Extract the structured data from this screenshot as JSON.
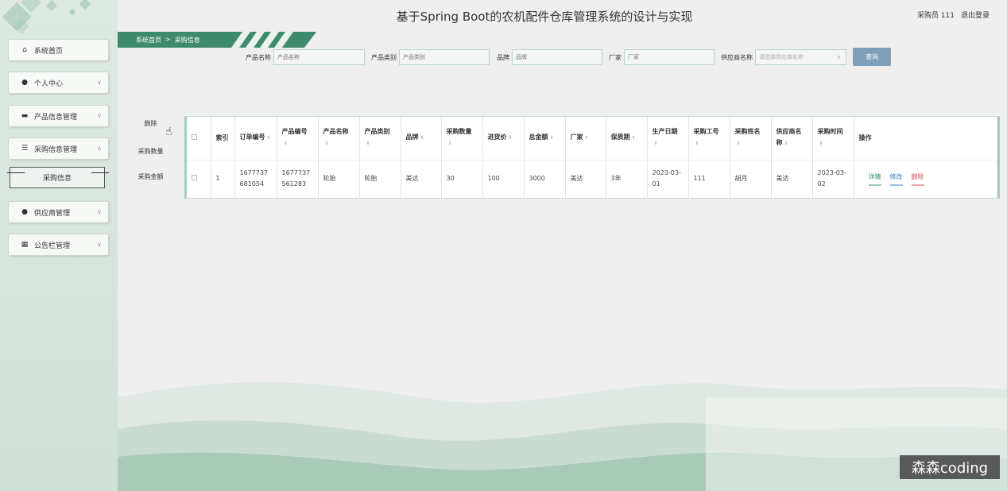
{
  "header": {
    "title": "基于Spring Boot的农机配件仓库管理系统的设计与实现",
    "user": "采购员 111",
    "logout": "退出登录"
  },
  "sidebar": {
    "items": [
      {
        "label": "系统首页",
        "icon": "home-icon"
      },
      {
        "label": "个人中心",
        "icon": "user-icon"
      },
      {
        "label": "产品信息管理",
        "icon": "monitor-icon"
      },
      {
        "label": "采购信息管理",
        "icon": "sliders-icon"
      },
      {
        "label": "供应商管理",
        "icon": "user-icon"
      },
      {
        "label": "公告栏管理",
        "icon": "grid-icon"
      }
    ],
    "sub_item": "采购信息"
  },
  "breadcrumb": {
    "home": "系统首页",
    "sep": ">",
    "current": "采购信息"
  },
  "search": {
    "product_name": {
      "label": "产品名称",
      "placeholder": "产品名称"
    },
    "product_type": {
      "label": "产品类别",
      "placeholder": "产品类别"
    },
    "brand": {
      "label": "品牌",
      "placeholder": "品牌"
    },
    "maker": {
      "label": "厂家",
      "placeholder": "厂家"
    },
    "supplier": {
      "label": "供应商名称",
      "placeholder": "请选择供应商名称"
    },
    "query": "查询"
  },
  "actions": {
    "delete": "删除",
    "qty": "采购数量",
    "amount": "采购金额"
  },
  "table": {
    "headers": {
      "idx": "索引",
      "order": "订单编号",
      "pcode": "产品编号",
      "pname": "产品名称",
      "ptype": "产品类别",
      "brand": "品牌",
      "qty": "采购数量",
      "price": "进货价",
      "total": "总金额",
      "maker": "厂家",
      "shelf": "保质期",
      "pdate": "生产日期",
      "staff": "采购工号",
      "sname": "采购姓名",
      "supplier": "供应商名称",
      "ptime": "采购时间",
      "op": "操作"
    },
    "row": {
      "idx": "1",
      "order": "1677737681054",
      "pcode": "1677737561283",
      "pname": "轮胎",
      "ptype": "轮胎",
      "brand": "美达",
      "qty": "30",
      "price": "100",
      "total": "3000",
      "maker": "美达",
      "shelf": "3年",
      "pdate": "2023-03-01",
      "staff": "111",
      "sname": "胡月",
      "supplier": "美达",
      "ptime": "2023-03-02"
    },
    "ops": {
      "detail": "详情",
      "edit": "修改",
      "del": "删除"
    }
  },
  "watermark": "森森coding"
}
